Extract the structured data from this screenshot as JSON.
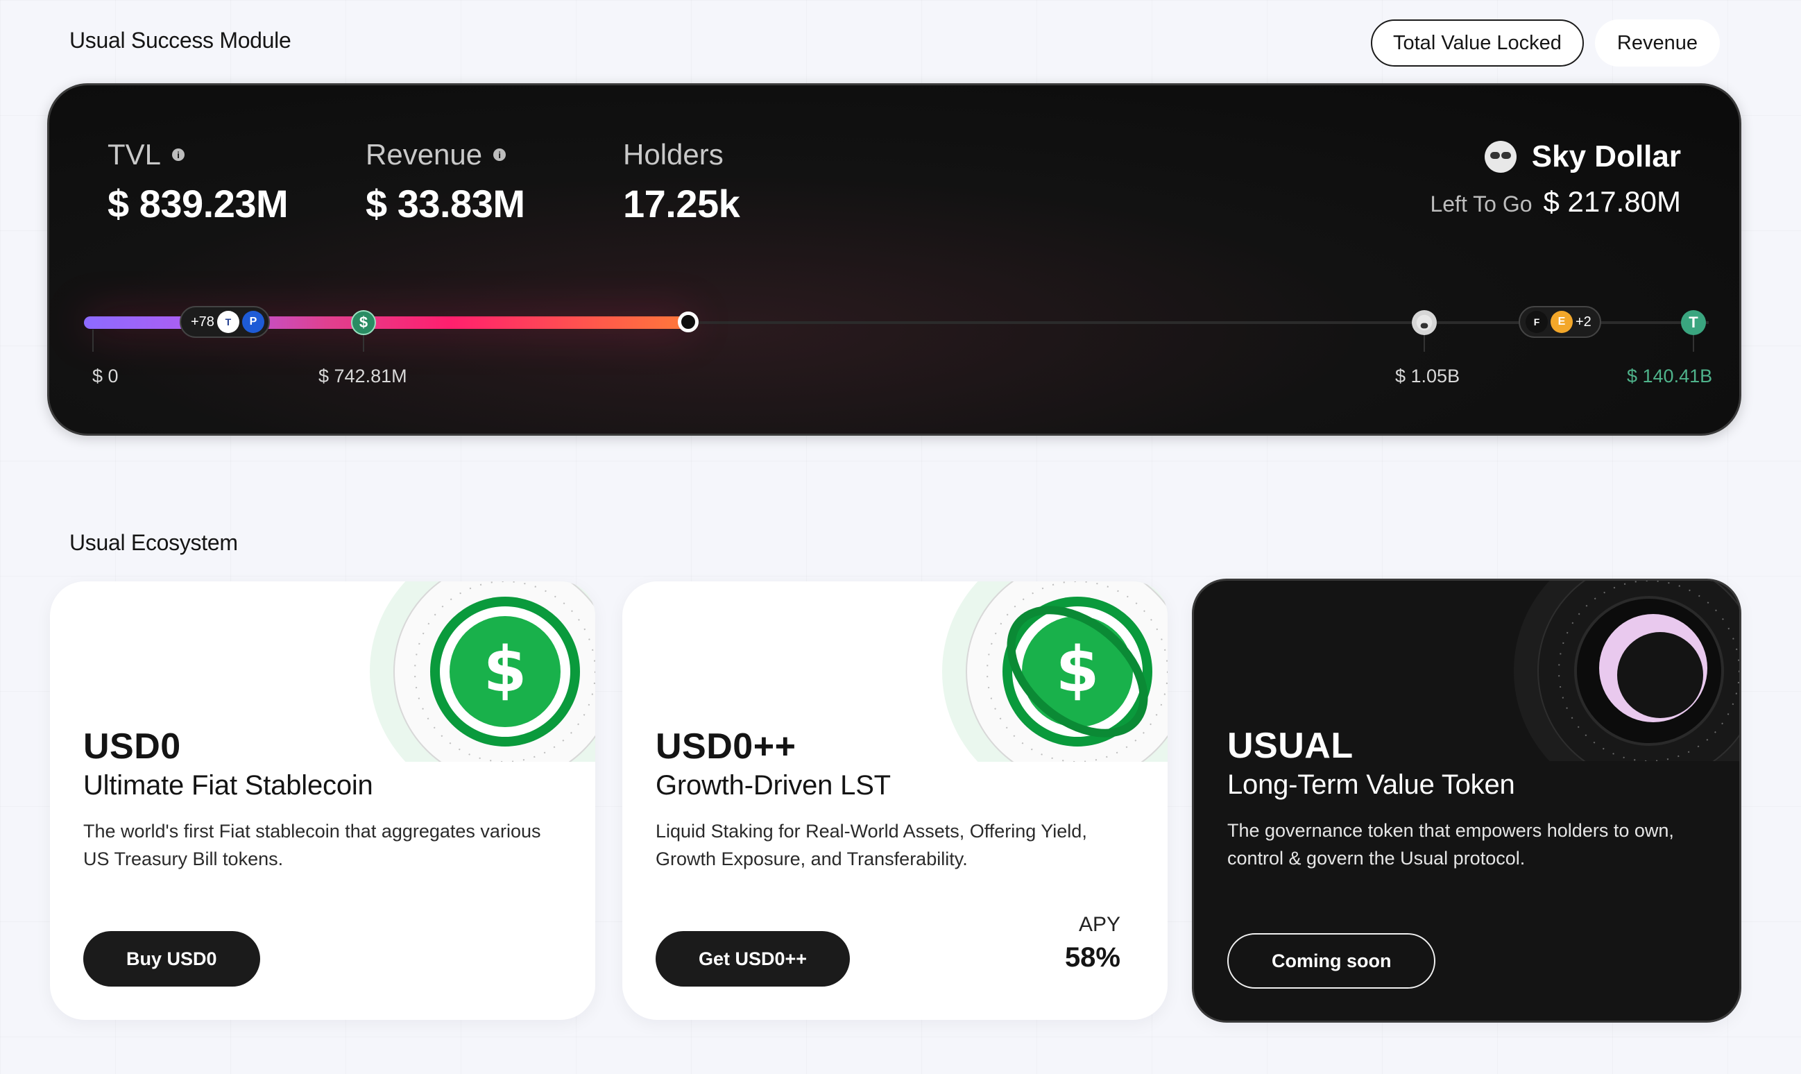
{
  "section_success": {
    "title": "Usual Success Module"
  },
  "toggle": {
    "tvl_label": "Total Value Locked",
    "revenue_label": "Revenue",
    "active": "Total Value Locked"
  },
  "stats": {
    "tvl": {
      "label": "TVL",
      "value": "$ 839.23M"
    },
    "revenue": {
      "label": "Revenue",
      "value": "$ 33.83M"
    },
    "holders": {
      "label": "Holders",
      "value": "17.25k"
    }
  },
  "target": {
    "name": "Sky Dollar",
    "left_label": "Left To Go",
    "left_value": "$ 217.80M"
  },
  "progress": {
    "fraction_filled": 0.374,
    "chip_a_count": "+78",
    "chip_b_count": "+2",
    "ticks": [
      "$ 0",
      "$ 742.81M",
      "$ 1.05B",
      "$ 140.41B"
    ],
    "accent": "#ff1f6e"
  },
  "section_ecosystem": {
    "title": "Usual Ecosystem"
  },
  "cards": [
    {
      "title": "USD0",
      "subtitle": "Ultimate Fiat Stablecoin",
      "desc": "The world's first Fiat stablecoin that aggregates various US Treasury Bill tokens.",
      "cta": "Buy USD0",
      "icon": "dollar-coin-icon"
    },
    {
      "title": "USD0++",
      "subtitle": "Growth-Driven LST",
      "desc": "Liquid Staking for Real-World Assets, Offering Yield, Growth Exposure, and Transferability.",
      "cta": "Get USD0++",
      "apy_label": "APY",
      "apy_value": "58%",
      "icon": "dollar-coin-ring-icon"
    },
    {
      "title": "USUAL",
      "subtitle": "Long-Term Value Token",
      "desc": "The governance token that empowers holders to own, control & govern the Usual protocol.",
      "cta": "Coming soon",
      "icon": "usual-token-icon"
    }
  ]
}
